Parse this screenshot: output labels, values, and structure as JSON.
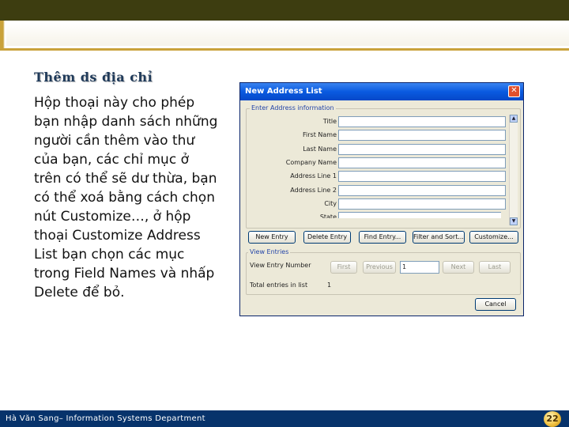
{
  "slide": {
    "title": "Thêm ds địa chỉ",
    "body": "Hộp thoại này cho phép bạn nhập danh sách những người cần thêm vào thư của bạn, các chỉ mục ở trên có thể sẽ dư thừa, bạn có thể xoá bằng cách chọn nút Customize…, ở hộp thoại Customize Address List  bạn chọn các mục trong Field Names và nhấp Delete để bỏ.",
    "footer": "Hà Văn Sang– Information Systems Department",
    "page_number": "22"
  },
  "dialog": {
    "title": "New Address List",
    "close_glyph": "✕",
    "enter_group_label": "Enter Address information",
    "fields": [
      {
        "label": "Title",
        "value": ""
      },
      {
        "label": "First Name",
        "value": ""
      },
      {
        "label": "Last Name",
        "value": ""
      },
      {
        "label": "Company Name",
        "value": ""
      },
      {
        "label": "Address Line 1",
        "value": ""
      },
      {
        "label": "Address Line 2",
        "value": ""
      },
      {
        "label": "City",
        "value": ""
      },
      {
        "label": "State",
        "value": ""
      }
    ],
    "buttons": {
      "new_entry": "New Entry",
      "delete_entry": "Delete Entry",
      "find_entry": "Find Entry...",
      "filter_sort": "Filter and Sort...",
      "customize": "Customize..."
    },
    "view_group_label": "View Entries",
    "view_entry_label": "View Entry Number",
    "nav": {
      "first": "First",
      "previous": "Previous",
      "entry_value": "1",
      "next": "Next",
      "last": "Last"
    },
    "total_label": "Total entries in list",
    "total_value": "1",
    "cancel": "Cancel"
  },
  "colors": {
    "top_bar": "#3d3d10",
    "accent_gold": "#c9a23a",
    "footer_bg": "#07336b",
    "title_color": "#1f3a5a",
    "xp_title_blue": "#0a5ae0"
  },
  "icons": {
    "close": "close-icon",
    "scroll_up": "scroll-up-icon",
    "scroll_down": "scroll-down-icon",
    "page_badge": "page-number-badge"
  }
}
